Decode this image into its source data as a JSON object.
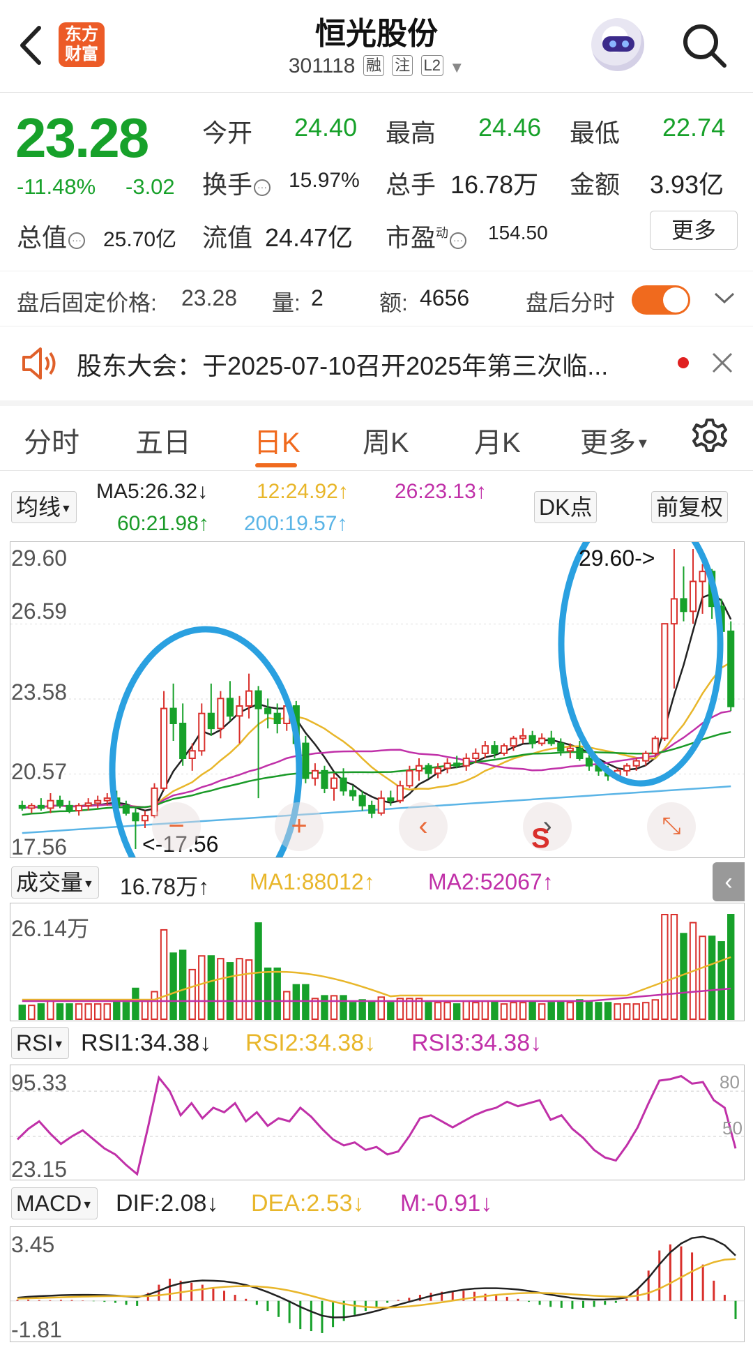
{
  "header": {
    "logo_line1": "东方",
    "logo_line2": "财富",
    "stock_name": "恒光股份",
    "stock_code": "301118",
    "tags": [
      "融",
      "注",
      "L2"
    ]
  },
  "quote": {
    "price": "23.28",
    "change_pct": "-11.48%",
    "change_amt": "-3.02",
    "open_label": "今开",
    "open": "24.40",
    "high_label": "最高",
    "high": "24.46",
    "low_label": "最低",
    "low": "22.74",
    "turnover_label": "换手",
    "turnover": "15.97%",
    "volume_label": "总手",
    "volume": "16.78万",
    "amount_label": "金额",
    "amount": "3.93亿",
    "mktcap_label": "总值",
    "mktcap": "25.70亿",
    "float_label": "流值",
    "float_cap": "24.47亿",
    "pe_label": "市盈",
    "pe_sup": "动",
    "pe": "154.50",
    "more_button": "更多"
  },
  "after_hours": {
    "price_label": "盘后固定价格:",
    "price": "23.28",
    "vol_label": "量:",
    "vol": "2",
    "amt_label": "额:",
    "amt": "4656",
    "toggle_label": "盘后分时",
    "toggle_on": true
  },
  "notice": {
    "text": "股东大会：于2025-07-10召开2025年第三次临..."
  },
  "tabs": [
    "分时",
    "五日",
    "日K",
    "周K",
    "月K",
    "更多"
  ],
  "active_tab": "日K",
  "kline": {
    "ma_button": "均线",
    "ma5": "MA5:26.32↓",
    "ma12": "12:24.92↑",
    "ma26": "26:23.13↑",
    "ma60": "60:21.98↑",
    "ma200": "200:19.57↑",
    "dk_button": "DK点",
    "fq_button": "前复权",
    "y_labels": [
      "29.60",
      "26.59",
      "23.58",
      "20.57",
      "17.56"
    ],
    "max_note": "29.60->",
    "min_note": "<-17.56",
    "colors": {
      "up": "#d9302c",
      "down": "#17a12a",
      "ma5": "#222222",
      "ma12": "#e8b62a",
      "ma26": "#c030a8",
      "ma60": "#1a9a28",
      "ma200": "#5ab4e6",
      "circle": "#2aa0e0"
    }
  },
  "volume_panel": {
    "select": "成交量",
    "vol": "16.78万↑",
    "ma1": "MA1:88012↑",
    "ma2": "MA2:52067↑",
    "top_label": "26.14万"
  },
  "rsi_panel": {
    "select": "RSI",
    "rsi1": "RSI1:34.38↓",
    "rsi2": "RSI2:34.38↓",
    "rsi3": "RSI3:34.38↓",
    "top_label": "95.33",
    "bottom_label": "23.15",
    "ref_80": "80",
    "ref_50": "50"
  },
  "macd_panel": {
    "select": "MACD",
    "dif": "DIF:2.08↓",
    "dea": "DEA:2.53↓",
    "m": "M:-0.91↓",
    "top_label": "3.45",
    "bottom_label": "-1.81"
  },
  "chart_data": {
    "type": "candlestick",
    "y_range": [
      17.56,
      29.6
    ],
    "ohlc": [
      [
        19.3,
        19.5,
        19.1,
        19.2
      ],
      [
        19.2,
        19.4,
        19.0,
        19.3
      ],
      [
        19.3,
        19.6,
        19.1,
        19.2
      ],
      [
        19.2,
        19.8,
        19.0,
        19.5
      ],
      [
        19.5,
        19.7,
        19.2,
        19.3
      ],
      [
        19.3,
        19.5,
        19.0,
        19.1
      ],
      [
        19.1,
        19.4,
        18.9,
        19.3
      ],
      [
        19.3,
        19.6,
        19.1,
        19.4
      ],
      [
        19.4,
        19.7,
        19.2,
        19.5
      ],
      [
        19.5,
        19.8,
        19.3,
        19.6
      ],
      [
        19.6,
        19.9,
        19.2,
        19.3
      ],
      [
        19.3,
        19.5,
        18.9,
        19.0
      ],
      [
        19.0,
        19.2,
        17.56,
        18.7
      ],
      [
        18.7,
        19.1,
        18.4,
        18.9
      ],
      [
        18.9,
        20.2,
        18.8,
        20.0
      ],
      [
        20.0,
        23.9,
        19.9,
        23.2
      ],
      [
        23.2,
        24.2,
        21.9,
        22.6
      ],
      [
        22.6,
        23.4,
        20.9,
        21.2
      ],
      [
        21.2,
        21.8,
        20.7,
        21.5
      ],
      [
        21.5,
        23.4,
        21.3,
        23.0
      ],
      [
        23.0,
        24.2,
        22.1,
        22.4
      ],
      [
        22.4,
        23.9,
        22.0,
        23.6
      ],
      [
        23.6,
        24.3,
        22.7,
        22.9
      ],
      [
        22.9,
        23.7,
        21.8,
        23.3
      ],
      [
        23.3,
        24.6,
        22.8,
        23.9
      ],
      [
        23.9,
        24.1,
        19.6,
        23.2
      ],
      [
        23.2,
        23.6,
        22.4,
        23.0
      ],
      [
        23.0,
        23.4,
        22.2,
        22.6
      ],
      [
        22.6,
        23.7,
        22.3,
        23.3
      ],
      [
        23.3,
        23.5,
        21.6,
        21.8
      ],
      [
        21.8,
        22.1,
        20.2,
        20.4
      ],
      [
        20.4,
        21.0,
        20.1,
        20.7
      ],
      [
        20.7,
        20.9,
        19.8,
        20.0
      ],
      [
        20.0,
        20.6,
        19.5,
        20.4
      ],
      [
        20.4,
        20.8,
        19.7,
        19.9
      ],
      [
        19.9,
        20.1,
        19.5,
        19.7
      ],
      [
        19.7,
        19.9,
        19.1,
        19.3
      ],
      [
        19.3,
        19.5,
        18.8,
        19.0
      ],
      [
        19.0,
        19.9,
        18.9,
        19.6
      ],
      [
        19.6,
        19.9,
        19.3,
        19.5
      ],
      [
        19.5,
        20.3,
        19.4,
        20.1
      ],
      [
        20.1,
        20.9,
        20.0,
        20.7
      ],
      [
        20.7,
        21.2,
        20.3,
        20.9
      ],
      [
        20.9,
        21.0,
        20.4,
        20.6
      ],
      [
        20.6,
        21.0,
        20.4,
        20.8
      ],
      [
        20.8,
        21.2,
        20.6,
        21.0
      ],
      [
        21.0,
        21.3,
        20.8,
        20.9
      ],
      [
        20.9,
        21.4,
        20.7,
        21.2
      ],
      [
        21.2,
        21.6,
        21.0,
        21.4
      ],
      [
        21.4,
        21.9,
        21.2,
        21.7
      ],
      [
        21.7,
        21.9,
        21.2,
        21.4
      ],
      [
        21.4,
        21.8,
        21.3,
        21.7
      ],
      [
        21.7,
        22.1,
        21.5,
        22.0
      ],
      [
        22.0,
        22.4,
        21.8,
        22.1
      ],
      [
        22.1,
        22.3,
        21.6,
        21.8
      ],
      [
        21.8,
        22.2,
        21.7,
        22.0
      ],
      [
        22.0,
        22.3,
        21.7,
        21.8
      ],
      [
        21.8,
        22.0,
        21.3,
        21.5
      ],
      [
        21.5,
        21.8,
        21.2,
        21.6
      ],
      [
        21.6,
        21.9,
        21.1,
        21.2
      ],
      [
        21.2,
        21.4,
        20.7,
        20.9
      ],
      [
        20.9,
        21.1,
        20.5,
        20.7
      ],
      [
        20.7,
        20.9,
        20.3,
        20.5
      ],
      [
        20.5,
        20.8,
        20.3,
        20.7
      ],
      [
        20.7,
        21.0,
        20.5,
        20.9
      ],
      [
        20.9,
        21.2,
        20.7,
        21.1
      ],
      [
        21.1,
        21.5,
        20.9,
        21.4
      ],
      [
        21.4,
        22.1,
        21.3,
        22.0
      ],
      [
        22.0,
        26.6,
        21.9,
        26.6
      ],
      [
        26.6,
        29.6,
        24.0,
        27.6
      ],
      [
        27.6,
        28.9,
        26.7,
        27.1
      ],
      [
        27.1,
        29.6,
        26.6,
        28.3
      ],
      [
        28.3,
        29.0,
        27.0,
        28.7
      ],
      [
        28.7,
        28.8,
        26.8,
        27.3
      ],
      [
        27.3,
        27.6,
        26.0,
        26.3
      ],
      [
        26.3,
        26.7,
        23.1,
        23.28
      ]
    ],
    "volume_max": "26.14万",
    "rsi_range": [
      23.15,
      95.33
    ],
    "rsi": [
      48,
      55,
      60,
      52,
      45,
      50,
      54,
      48,
      42,
      38,
      31,
      25,
      56,
      89,
      80,
      64,
      72,
      62,
      69,
      66,
      72,
      60,
      66,
      57,
      62,
      60,
      69,
      63,
      55,
      48,
      44,
      46,
      41,
      43,
      38,
      40,
      50,
      62,
      64,
      60,
      56,
      60,
      64,
      67,
      69,
      73,
      70,
      72,
      74,
      61,
      64,
      55,
      49,
      41,
      36,
      34,
      44,
      56,
      72,
      87,
      88,
      90,
      85,
      86,
      74,
      69,
      42
    ],
    "macd_range": [
      -1.81,
      3.45
    ],
    "macd_hist": [
      0.05,
      0.06,
      0.04,
      0.03,
      0.05,
      0.04,
      0.02,
      -0.02,
      -0.05,
      -0.1,
      -0.2,
      -0.25,
      0.4,
      0.8,
      1.1,
      1.0,
      0.9,
      0.8,
      0.6,
      0.5,
      0.3,
      0.1,
      -0.2,
      -0.5,
      -0.8,
      -1.1,
      -1.4,
      -1.5,
      -1.6,
      -1.3,
      -1.0,
      -0.7,
      -0.5,
      -0.3,
      -0.1,
      0.05,
      0.15,
      0.3,
      0.4,
      0.45,
      0.5,
      0.5,
      0.45,
      0.35,
      0.3,
      0.2,
      0.1,
      -0.05,
      -0.2,
      -0.3,
      -0.35,
      -0.4,
      -0.35,
      -0.3,
      -0.2,
      -0.1,
      0.1,
      0.6,
      1.5,
      2.5,
      2.8,
      2.7,
      2.4,
      1.8,
      1.0,
      0.3,
      -0.91
    ]
  }
}
